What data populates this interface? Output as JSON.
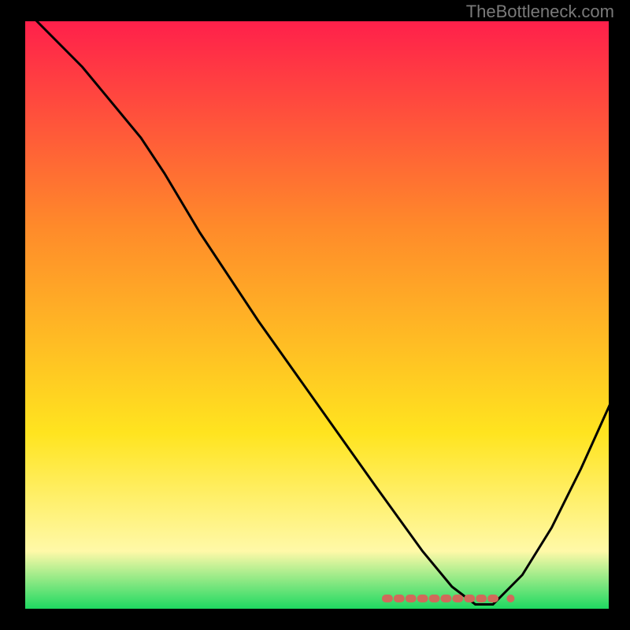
{
  "watermark": "TheBottleneck.com",
  "chart_data": {
    "type": "line",
    "title": "",
    "xlabel": "",
    "ylabel": "",
    "xlim": [
      0,
      100
    ],
    "ylim": [
      0,
      100
    ],
    "background_gradient": {
      "top": "#ff1f4b",
      "mid1": "#ff8a2a",
      "mid2": "#ffe41f",
      "mid3": "#fff9a8",
      "bottom": "#18d85f"
    },
    "series": [
      {
        "name": "bottleneck-curve",
        "color": "#000000",
        "x": [
          2,
          10,
          20,
          24,
          30,
          40,
          50,
          60,
          68,
          73,
          77,
          80,
          85,
          90,
          95,
          100
        ],
        "values": [
          100,
          92,
          80,
          74,
          64,
          49,
          35,
          21,
          10,
          4,
          1,
          1,
          6,
          14,
          24,
          35
        ]
      }
    ],
    "markers": {
      "name": "optimal-range",
      "color": "#d06a5a",
      "x": [
        62,
        64,
        66,
        68,
        70,
        72,
        74,
        76,
        78,
        80,
        83
      ],
      "values": [
        2,
        2,
        2,
        2,
        2,
        2,
        2,
        2,
        2,
        2,
        2
      ]
    }
  }
}
